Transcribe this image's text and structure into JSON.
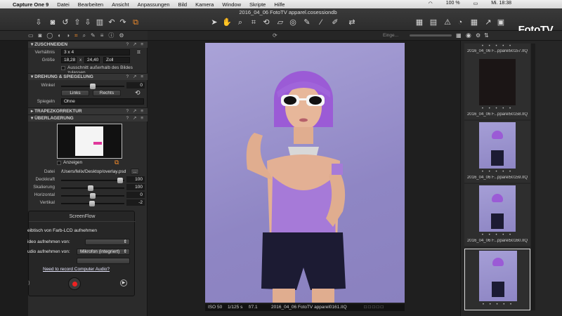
{
  "menubar": {
    "apple": "",
    "app_name": "Capture One 9",
    "items": [
      "Datei",
      "Bearbeiten",
      "Ansicht",
      "Anpassungen",
      "Bild",
      "Kamera",
      "Window",
      "Skripte",
      "Hilfe"
    ],
    "status": {
      "battery": "100 %",
      "clock": "Mi. 18:38"
    }
  },
  "toolbar": {
    "document_title": "2016_04_06 FotoTV apparel.cosessiondb",
    "brand": "FotoTV."
  },
  "left_panel": {
    "crop": {
      "title": "ZUSCHNEIDEN",
      "ratio_label": "Verhältnis",
      "ratio_value": "3 x 4",
      "size_label": "Größe",
      "width": "18,28",
      "times": "x",
      "height": "24,40",
      "unit": "Zoll",
      "outside_checkbox": "Ausschnitt außerhalb des Bildes zulassen"
    },
    "rotation": {
      "title": "DREHUNG & SPIEGELUNG",
      "angle_label": "Winkel",
      "angle_value": "0",
      "left_button": "Links",
      "right_button": "Rechts",
      "mirror_label": "Spiegeln",
      "mirror_value": "Ohne"
    },
    "keystone": {
      "title": "TRAPEZKORREKTUR"
    },
    "overlay": {
      "title": "ÜBERLAGERUNG",
      "show_label": "Anzeigen",
      "file_label": "Datei",
      "file_path": "/Users/felix/Desktop/overlay.psd",
      "browse_button": "...",
      "opacity_label": "Deckkraft",
      "opacity_value": "100",
      "scale_label": "Skalierung",
      "scale_value": "100",
      "horizontal_label": "Horizontal",
      "horizontal_value": "0",
      "vertical_label": "Vertikal",
      "vertical_value": "-2"
    }
  },
  "screenflow": {
    "title": "ScreenFlow",
    "record_desktop": "eibtisch von Farb-LCD aufnehmen",
    "video_label": "ideo aufnehmen von:",
    "audio_label": "udio aufnehmen von:",
    "audio_source": "Mikrofon (integriert)",
    "help_link": "Need to record Computer Audio?"
  },
  "viewer": {
    "search_placeholder": "Einge...",
    "info": {
      "iso": "ISO 50",
      "shutter": "1/125 s",
      "aperture": "f/7.1",
      "filename": "2016_04_06 FotoTV apparel0161.IIQ"
    }
  },
  "browser": {
    "thumbnails": [
      {
        "caption": "2016_04_06 F...pparel50157.IIQ",
        "rating": "• • • • •"
      },
      {
        "caption": "2016_04_06 F...pparel50158.IIQ",
        "rating": "• • • • •"
      },
      {
        "caption": "2016_04_06 F...pparel50159.IIQ",
        "rating": "• • • • •"
      },
      {
        "caption": "2016_04_06 F...pparel50160.IIQ",
        "rating": "• • • • •"
      },
      {
        "caption": "2016_04_06 F...pparel50161.IIQ",
        "rating": "• • • • •"
      }
    ]
  },
  "colors": {
    "accent": "#f08a2a",
    "background": "#1e1e1e",
    "panel": "#2b2b2b",
    "backdrop": "#9a92cf",
    "wig": "#9b5bd6"
  }
}
